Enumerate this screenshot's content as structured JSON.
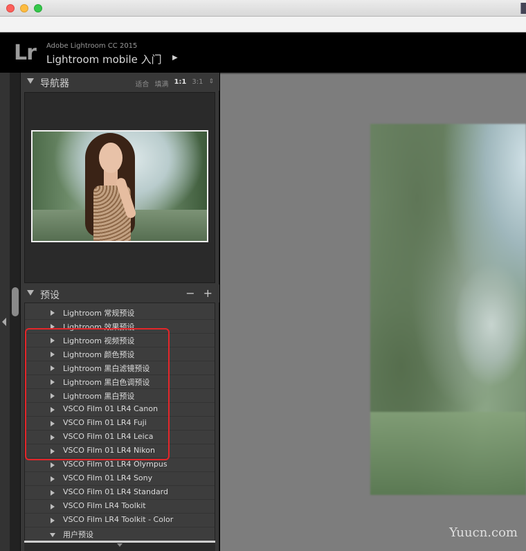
{
  "header": {
    "app_name": "Adobe Lightroom CC 2015",
    "module_title": "Lightroom mobile 入门",
    "logo_text": "Lr",
    "arrow": "▶"
  },
  "navigator": {
    "title": "导航器",
    "options": [
      "适合",
      "填满",
      "1:1",
      "3:1"
    ],
    "selected_option": "1:1",
    "updown": "⇕"
  },
  "presets": {
    "title": "预设",
    "minus": "−",
    "plus": "+",
    "items": [
      {
        "label": "Lightroom 常规预设",
        "expanded": false
      },
      {
        "label": "Lightroom 效果预设",
        "expanded": false
      },
      {
        "label": "Lightroom 视频预设",
        "expanded": false
      },
      {
        "label": "Lightroom 颜色预设",
        "expanded": false
      },
      {
        "label": "Lightroom 黑白滤镜预设",
        "expanded": false
      },
      {
        "label": "Lightroom 黑白色调预设",
        "expanded": false
      },
      {
        "label": "Lightroom 黑白预设",
        "expanded": false
      },
      {
        "label": "VSCO Film 01 LR4 Canon",
        "expanded": false
      },
      {
        "label": "VSCO Film 01 LR4 Fuji",
        "expanded": false
      },
      {
        "label": "VSCO Film 01 LR4 Leica",
        "expanded": false
      },
      {
        "label": "VSCO Film 01 LR4 Nikon",
        "expanded": false
      },
      {
        "label": "VSCO Film 01 LR4 Olympus",
        "expanded": false
      },
      {
        "label": "VSCO Film 01 LR4 Sony",
        "expanded": false
      },
      {
        "label": "VSCO Film 01 LR4 Standard",
        "expanded": false
      },
      {
        "label": "VSCO Film LR4 Toolkit",
        "expanded": false
      },
      {
        "label": "VSCO Film LR4 Toolkit - Color",
        "expanded": false
      },
      {
        "label": "用户预设",
        "expanded": true
      }
    ]
  },
  "watermark": "Yuucn.com",
  "colors": {
    "highlight": "#e4262a",
    "panel_bg": "#383838",
    "main_bg": "#7d7d7d"
  }
}
